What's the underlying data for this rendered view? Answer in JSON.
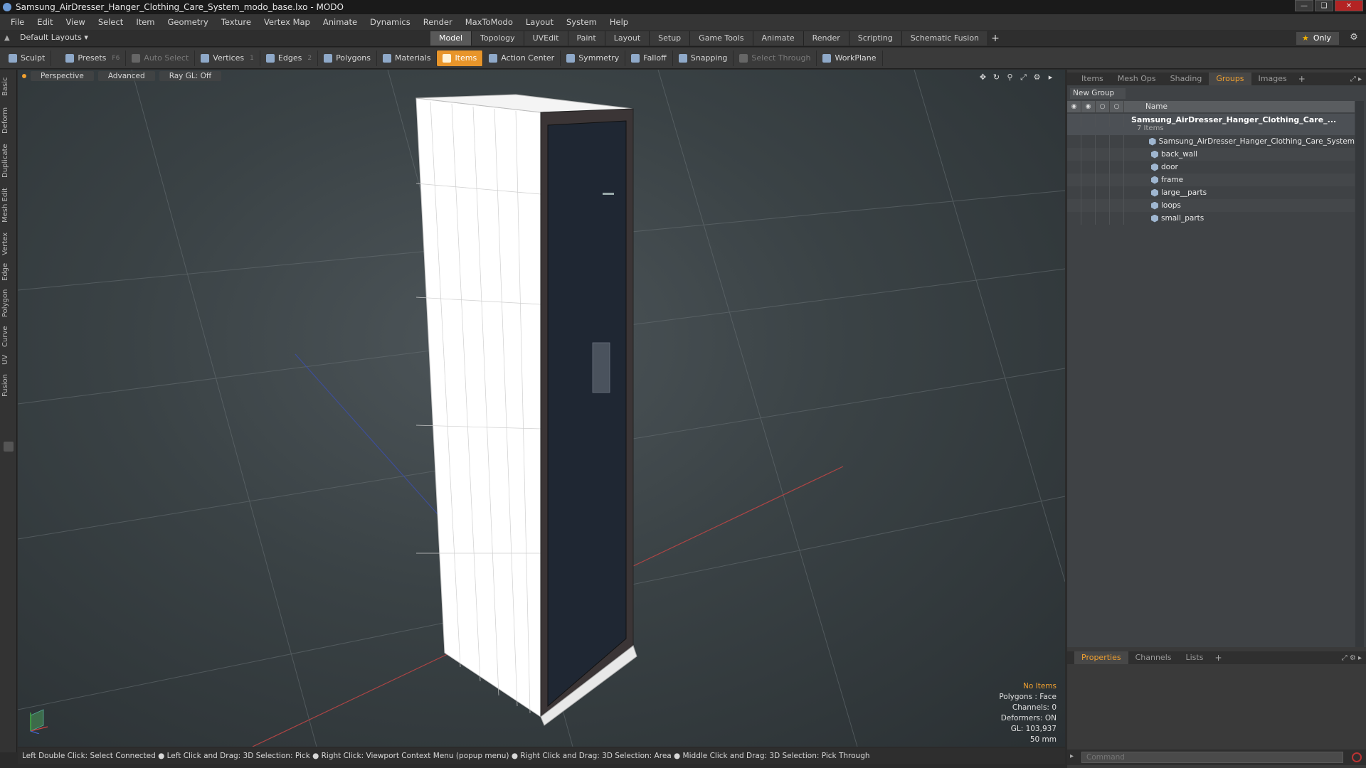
{
  "window": {
    "title": "Samsung_AirDresser_Hanger_Clothing_Care_System_modo_base.lxo - MODO"
  },
  "menu": [
    "File",
    "Edit",
    "View",
    "Select",
    "Item",
    "Geometry",
    "Texture",
    "Vertex Map",
    "Animate",
    "Dynamics",
    "Render",
    "MaxToModo",
    "Layout",
    "System",
    "Help"
  ],
  "layout": {
    "preset": "Default Layouts",
    "tabs": [
      "Model",
      "Topology",
      "UVEdit",
      "Paint",
      "Layout",
      "Setup",
      "Game Tools",
      "Animate",
      "Render",
      "Scripting",
      "Schematic Fusion"
    ],
    "active_tab": "Model",
    "only_label": "Only"
  },
  "toolbar": {
    "sculpt": "Sculpt",
    "presets": "Presets",
    "presets_key": "F6",
    "auto_select": "Auto Select",
    "vertices": "Vertices",
    "vertices_count": "1",
    "edges": "Edges",
    "edges_count": "2",
    "polygons": "Polygons",
    "materials": "Materials",
    "items": "Items",
    "action_center": "Action Center",
    "symmetry": "Symmetry",
    "falloff": "Falloff",
    "snapping": "Snapping",
    "select_through": "Select Through",
    "workplane": "WorkPlane"
  },
  "left_tabs": [
    "Basic",
    "Deform",
    "Duplicate",
    "Mesh Edit",
    "Vertex",
    "Edge",
    "Polygon",
    "Curve",
    "UV",
    "Fusion"
  ],
  "viewport": {
    "view": "Perspective",
    "shading": "Advanced",
    "raygl": "Ray GL: Off",
    "info": {
      "selection": "No Items",
      "polygons": "Polygons : Face",
      "channels": "Channels: 0",
      "deformers": "Deformers: ON",
      "gl": "GL: 103,937",
      "scale": "50 mm"
    }
  },
  "status": "Left Double Click: Select Connected ● Left Click and Drag: 3D Selection: Pick ● Right Click: Viewport Context Menu (popup menu) ● Right Click and Drag: 3D Selection: Area ● Middle Click and Drag: 3D Selection: Pick Through",
  "right_panel": {
    "tabs": [
      "Items",
      "Mesh Ops",
      "Shading",
      "Groups",
      "Images"
    ],
    "active_tab": "Groups",
    "new_group": "New Group",
    "column_name": "Name",
    "root": {
      "name": "Samsung_AirDresser_Hanger_Clothing_Care_...",
      "count": "7 Items"
    },
    "children": [
      "Samsung_AirDresser_Hanger_Clothing_Care_System",
      "back_wall",
      "door",
      "frame",
      "large__parts",
      "loops",
      "small_parts"
    ],
    "bottom_tabs": [
      "Properties",
      "Channels",
      "Lists"
    ],
    "bottom_active": "Properties",
    "command_placeholder": "Command"
  }
}
